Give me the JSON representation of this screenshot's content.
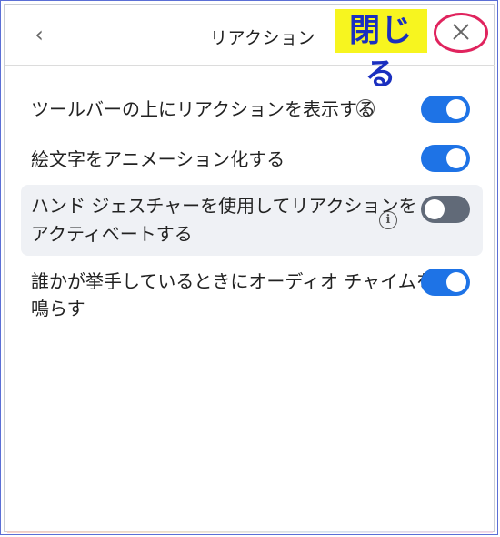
{
  "header": {
    "back_icon": "chevron-left-icon",
    "back_glyph": "‹",
    "title": "リアクション",
    "close_icon": "close-icon"
  },
  "annotation": {
    "label": "閉じる",
    "label_color": "#1a2fbf",
    "label_bg": "#f7f51f",
    "circle_color": "#e0245e"
  },
  "settings": [
    {
      "lines": [
        "ツールバーの上にリアクションを表示する"
      ],
      "info": true,
      "enabled": true
    },
    {
      "lines": [
        "絵文字をアニメーション化する"
      ],
      "info": false,
      "enabled": true
    },
    {
      "lines": [
        "ハンド ジェスチャーを使用してリアクションを",
        "アクティベートする"
      ],
      "info": true,
      "enabled": false
    },
    {
      "lines": [
        "誰かが挙手しているときにオーディオ チャイムを",
        "鳴らす"
      ],
      "info": false,
      "enabled": true
    }
  ],
  "info_glyph": "i",
  "colors": {
    "toggle_on": "#1e73e6",
    "toggle_off": "#616a78",
    "highlight_row": "#eff1f5"
  }
}
